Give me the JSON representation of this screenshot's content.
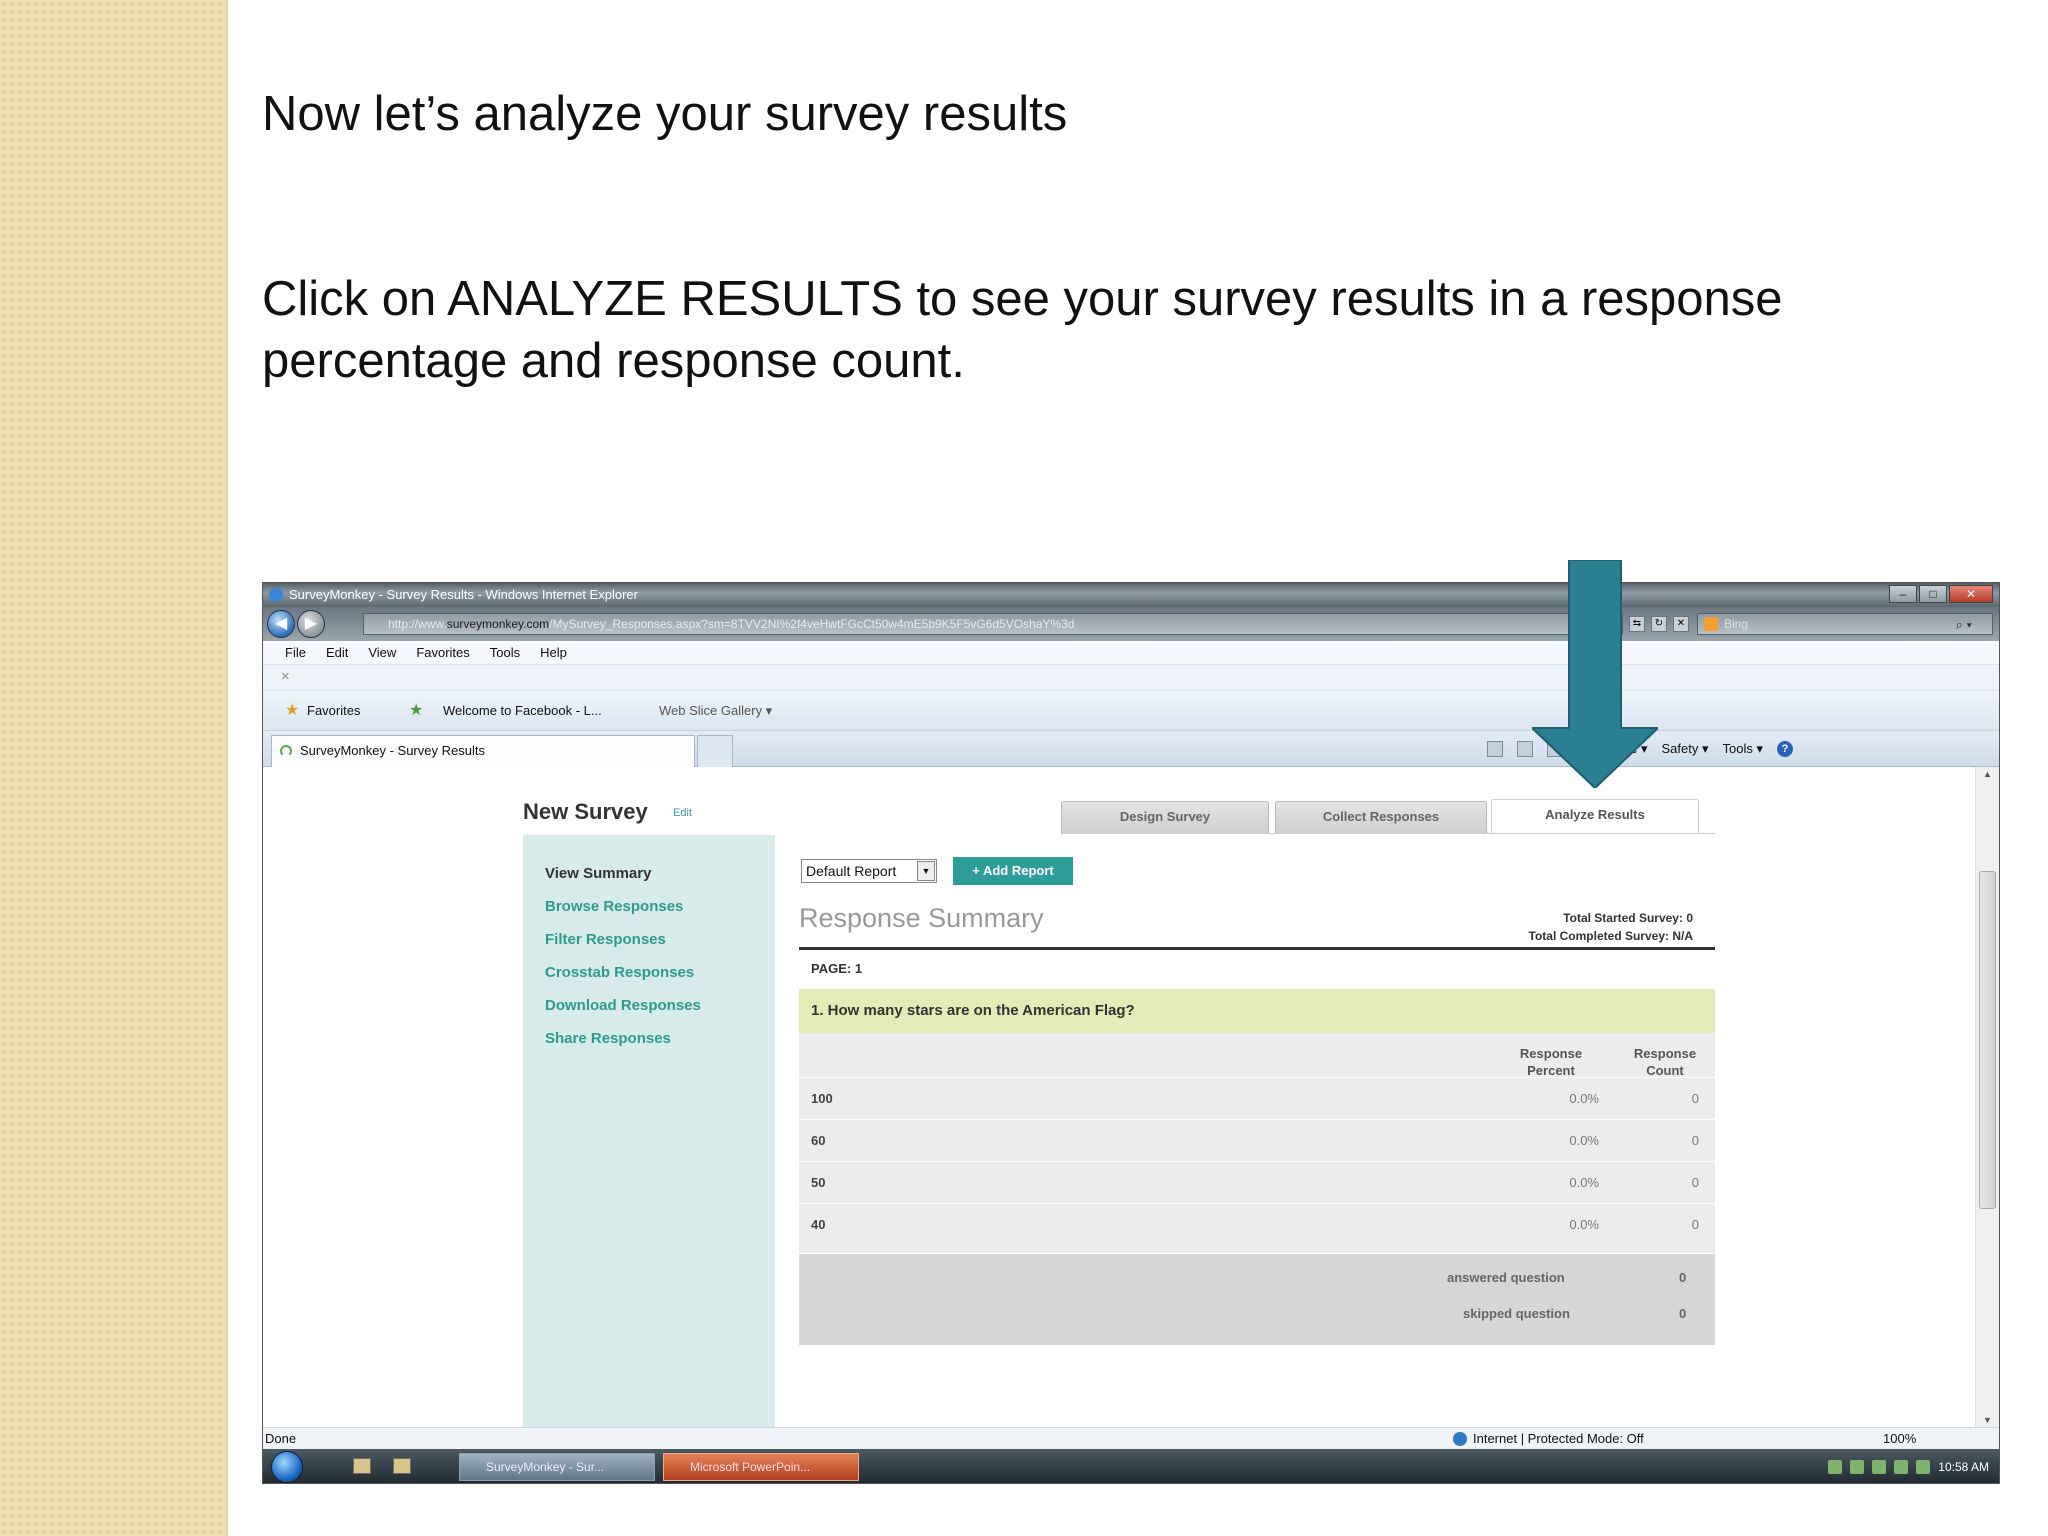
{
  "slide": {
    "title": "Now let’s analyze your survey results",
    "body": "Click on ANALYZE RESULTS  to see your survey results  in a response percentage and response count."
  },
  "browser": {
    "window_title": "SurveyMonkey - Survey Results - Windows Internet Explorer",
    "address_prefix": "http://www.",
    "address_domain": "surveymonkey.com",
    "address_rest": "/MySurvey_Responses.aspx?sm=8TVV2NI%2f4veHwtFGcCt50w4mE5b9K5F5vG6d5VOshaY%3d",
    "search_placeholder": "Bing",
    "menu": [
      "File",
      "Edit",
      "View",
      "Favorites",
      "Tools",
      "Help"
    ],
    "x_bar": "×",
    "favorites_label": "Favorites",
    "fav_links": [
      "Welcome to Facebook - L...",
      "Web Slice Gallery ▾"
    ],
    "tab_title": "SurveyMonkey - Survey Results",
    "command_bar": [
      "Page ▾",
      "Safety ▾",
      "Tools ▾"
    ],
    "status_left": "Done",
    "status_zone": "Internet | Protected Mode: Off",
    "status_zoom": "100%"
  },
  "survey": {
    "title": "New Survey",
    "edit": "Edit",
    "tabs": [
      "Design Survey",
      "Collect Responses",
      "Analyze Results"
    ],
    "nav": [
      "View Summary",
      "Browse Responses",
      "Filter Responses",
      "Crosstab Responses",
      "Download Responses",
      "Share Responses"
    ],
    "report_select": "Default Report",
    "add_report": "+ Add Report",
    "summary_title": "Response Summary",
    "total_started": "Total Started Survey: 0",
    "total_completed": "Total Completed Survey: N/A",
    "page_label": "PAGE: 1",
    "question": "1. How many stars are on the American Flag?",
    "col_percent": "Response Percent",
    "col_count": "Response Count",
    "rows": [
      {
        "label": "100",
        "percent": "0.0%",
        "count": "0"
      },
      {
        "label": "60",
        "percent": "0.0%",
        "count": "0"
      },
      {
        "label": "50",
        "percent": "0.0%",
        "count": "0"
      },
      {
        "label": "40",
        "percent": "0.0%",
        "count": "0"
      }
    ],
    "answered_label": "answered question",
    "answered_value": "0",
    "skipped_label": "skipped question",
    "skipped_value": "0"
  },
  "taskbar": {
    "buttons": [
      "SurveyMonkey - Sur...",
      "Microsoft PowerPoin..."
    ],
    "clock": "10:58 AM"
  },
  "colors": {
    "accent_teal": "#2e9d9a",
    "arrow_teal": "#2b7f93",
    "question_bar": "#e3ebb8",
    "nav_bg": "#d6ebea"
  }
}
